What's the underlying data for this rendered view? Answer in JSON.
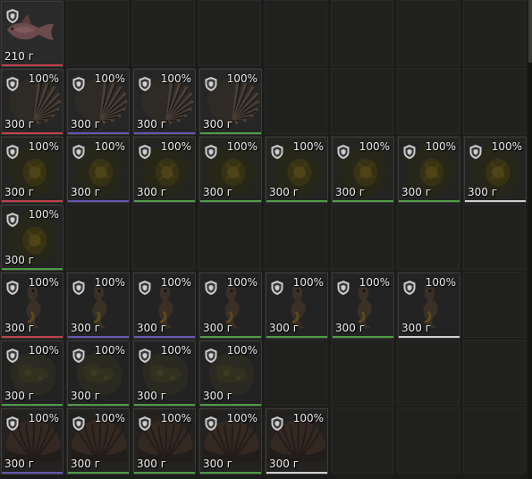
{
  "inventory": {
    "rows": [
      {
        "slots": [
          {
            "weight": "210 г",
            "durability": "",
            "quality": "#c0414b",
            "art": "fish"
          }
        ]
      },
      {
        "slots": [
          {
            "weight": "300 г",
            "durability": "100%",
            "quality": "#c0414b",
            "art": "shell"
          },
          {
            "weight": "300 г",
            "durability": "100%",
            "quality": "#6655b0",
            "art": "shell"
          },
          {
            "weight": "300 г",
            "durability": "100%",
            "quality": "#6655b0",
            "art": "shell"
          },
          {
            "weight": "300 г",
            "durability": "100%",
            "quality": "#4f9a48",
            "art": "shell"
          }
        ]
      },
      {
        "slots": [
          {
            "weight": "300 г",
            "durability": "100%",
            "quality": "#c0414b",
            "art": "egg"
          },
          {
            "weight": "300 г",
            "durability": "100%",
            "quality": "#6655b0",
            "art": "egg"
          },
          {
            "weight": "300 г",
            "durability": "100%",
            "quality": "#4f9a48",
            "art": "egg"
          },
          {
            "weight": "300 г",
            "durability": "100%",
            "quality": "#4f9a48",
            "art": "egg"
          },
          {
            "weight": "300 г",
            "durability": "100%",
            "quality": "#4f9a48",
            "art": "egg"
          },
          {
            "weight": "300 г",
            "durability": "100%",
            "quality": "#4f9a48",
            "art": "egg"
          },
          {
            "weight": "300 г",
            "durability": "100%",
            "quality": "#4f9a48",
            "art": "egg"
          },
          {
            "weight": "300 г",
            "durability": "100%",
            "quality": "#cfcfcf",
            "art": "egg"
          }
        ]
      },
      {
        "slots": [
          {
            "weight": "300 г",
            "durability": "100%",
            "quality": "#4f9a48",
            "art": "egg"
          }
        ]
      },
      {
        "slots": [
          {
            "weight": "300 г",
            "durability": "100%",
            "quality": "#c0414b",
            "art": "seahorse"
          },
          {
            "weight": "300 г",
            "durability": "100%",
            "quality": "#6655b0",
            "art": "seahorse"
          },
          {
            "weight": "300 г",
            "durability": "100%",
            "quality": "#6655b0",
            "art": "seahorse"
          },
          {
            "weight": "300 г",
            "durability": "100%",
            "quality": "#4f9a48",
            "art": "seahorse"
          },
          {
            "weight": "300 г",
            "durability": "100%",
            "quality": "#4f9a48",
            "art": "seahorse"
          },
          {
            "weight": "300 г",
            "durability": "100%",
            "quality": "#4f9a48",
            "art": "seahorse"
          },
          {
            "weight": "300 г",
            "durability": "100%",
            "quality": "#cfcfcf",
            "art": "seahorse"
          }
        ]
      },
      {
        "slots": [
          {
            "weight": "300 г",
            "durability": "100%",
            "quality": "#4f9a48",
            "art": "stone"
          },
          {
            "weight": "300 г",
            "durability": "100%",
            "quality": "#4f9a48",
            "art": "stone"
          },
          {
            "weight": "300 г",
            "durability": "100%",
            "quality": "#4f9a48",
            "art": "stone"
          },
          {
            "weight": "300 г",
            "durability": "100%",
            "quality": "#4f9a48",
            "art": "stone"
          }
        ]
      },
      {
        "slots": [
          {
            "weight": "300 г",
            "durability": "100%",
            "quality": "#6655b0",
            "art": "clam"
          },
          {
            "weight": "300 г",
            "durability": "100%",
            "quality": "#4f9a48",
            "art": "clam"
          },
          {
            "weight": "300 г",
            "durability": "100%",
            "quality": "#4f9a48",
            "art": "clam"
          },
          {
            "weight": "300 г",
            "durability": "100%",
            "quality": "#4f9a48",
            "art": "clam"
          },
          {
            "weight": "300 г",
            "durability": "100%",
            "quality": "#cfcfcf",
            "art": "clam"
          }
        ]
      }
    ],
    "icons": {
      "protect": "shield-icon"
    }
  }
}
